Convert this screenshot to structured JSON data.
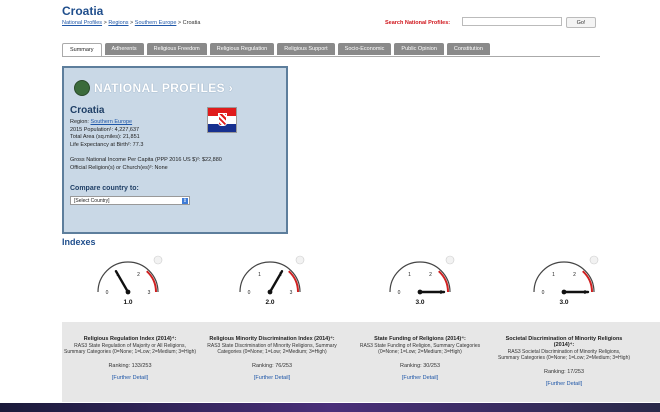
{
  "page": {
    "title": "Croatia",
    "breadcrumb": {
      "items": [
        "National Profiles",
        "Regions",
        "Southern Europe"
      ],
      "current": "Croatia",
      "sep": ">"
    },
    "search": {
      "label": "Search National Profiles:",
      "placeholder": "",
      "go_label": "Go!"
    }
  },
  "tabs": [
    {
      "label": "Summary",
      "active": true
    },
    {
      "label": "Adherents"
    },
    {
      "label": "Religious Freedom"
    },
    {
      "label": "Religious Regulation"
    },
    {
      "label": "Religious Support"
    },
    {
      "label": "Socio-Economic"
    },
    {
      "label": "Public Opinion"
    },
    {
      "label": "Constitution"
    }
  ],
  "profile": {
    "logo_text": "NATIONAL PROFILES ›",
    "country": "Croatia",
    "region_label": "Region: ",
    "region_link": "Southern Europe",
    "population": "2015 Population¹: 4,227,637",
    "area": "Total Area (sq.miles): 21,851",
    "life_expectancy": "Life Expectancy at Birth²: 77.3",
    "gni": "Gross National Income Per Capita (PPP 2016 US $)²: $22,880",
    "religion": "Official Religion(s) or Church(es)³: None",
    "compare_label": "Compare country to:",
    "select_value": "[Select Country]",
    "select_arrow": "⇕"
  },
  "indexes": {
    "title": "Indexes",
    "gauges": [
      {
        "value": 1.0,
        "label": "1.0"
      },
      {
        "value": 2.0,
        "label": "2.0"
      },
      {
        "value": 3.0,
        "label": "3.0"
      },
      {
        "value": 3.0,
        "label": "3.0"
      }
    ],
    "gauge_ticks": [
      "0",
      "1",
      "2",
      "3"
    ],
    "cards": [
      {
        "title": "Religious Regulation Index (2014)⁴:",
        "desc": "RAS3 State Regulation of Majority or All Religions, Summary Categories (0=None; 1=Low; 2=Medium; 3=High)",
        "ranking": "Ranking: 133/253",
        "link": "[Further Detail]"
      },
      {
        "title": "Religious Minority Discrimination Index (2014)⁴:",
        "desc": "RAS3 State Discrimination of Minority Religions, Summary Categories (0=None; 1=Low; 2=Medium; 3=High)",
        "ranking": "Ranking: 76/253",
        "link": "[Further Detail]"
      },
      {
        "title": "State Funding of Religions (2014)⁴:",
        "desc": "RAS3 State Funding of Religion, Summary Categories (0=None; 1=Low; 2=Medium; 3=High)",
        "ranking": "Ranking: 30/253",
        "link": "[Further Detail]"
      },
      {
        "title": "Societal Discrimination of Minority Religions (2014)⁴:",
        "desc": "RAS3 Societal Discrimination of Minority Religions, Summary Categories (0=None; 1=Low; 2=Medium; 3=High)",
        "ranking": "Ranking: 17/253",
        "link": "[Further Detail]"
      }
    ]
  },
  "colors": {
    "brand_blue": "#1f4e8c",
    "link_blue": "#1f57a8",
    "search_red": "#d0161c",
    "panel_bg": "#c9d8e6",
    "tab_gray": "#8a8a8a",
    "flag_red": "#e01b1b",
    "flag_blue": "#17308f"
  }
}
